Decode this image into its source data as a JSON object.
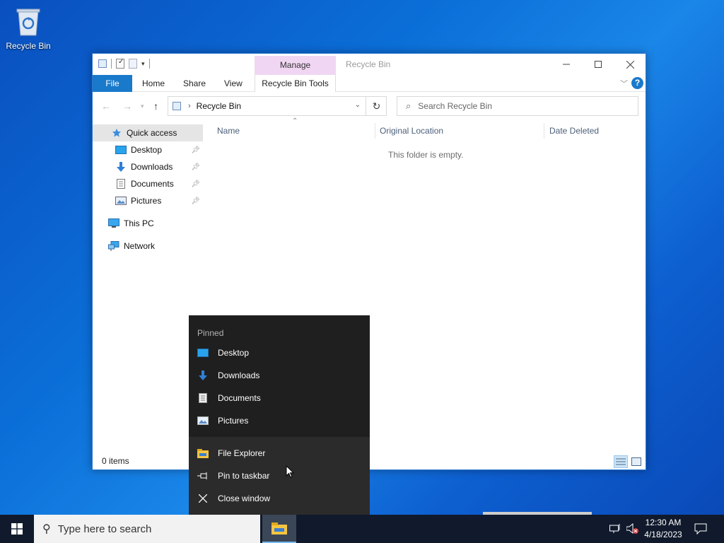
{
  "desktop": {
    "recycle_bin_label": "Recycle Bin"
  },
  "window": {
    "title": "Recycle Bin",
    "manage_tab": "Manage",
    "ribbon_tabs": [
      "File",
      "Home",
      "Share",
      "View",
      "Recycle Bin Tools"
    ],
    "breadcrumb": "Recycle Bin",
    "search_placeholder": "Search Recycle Bin",
    "nav": [
      {
        "label": "Quick access",
        "icon": "star-icon"
      },
      {
        "label": "Desktop",
        "icon": "desktop-folder-icon",
        "pinned": true
      },
      {
        "label": "Downloads",
        "icon": "download-arrow-icon",
        "pinned": true
      },
      {
        "label": "Documents",
        "icon": "document-icon",
        "pinned": true
      },
      {
        "label": "Pictures",
        "icon": "pictures-icon",
        "pinned": true
      },
      {
        "label": "This PC",
        "icon": "computer-icon"
      },
      {
        "label": "Network",
        "icon": "network-icon"
      }
    ],
    "columns": [
      "Name",
      "Original Location",
      "Date Deleted"
    ],
    "empty_message": "This folder is empty.",
    "status": "0 items"
  },
  "jumplist": {
    "header": "Pinned",
    "pinned": [
      "Desktop",
      "Downloads",
      "Documents",
      "Pictures"
    ],
    "actions": [
      "File Explorer",
      "Pin to taskbar",
      "Close window"
    ]
  },
  "taskbar": {
    "search_placeholder": "Type here to search",
    "time": "12:30 AM",
    "date": "4/18/2023"
  },
  "colors": {
    "accent": "#1979ca",
    "manage_tab": "#f1d6f3",
    "taskbar": "#101a2c",
    "jumplist": "#1f1f1f"
  }
}
